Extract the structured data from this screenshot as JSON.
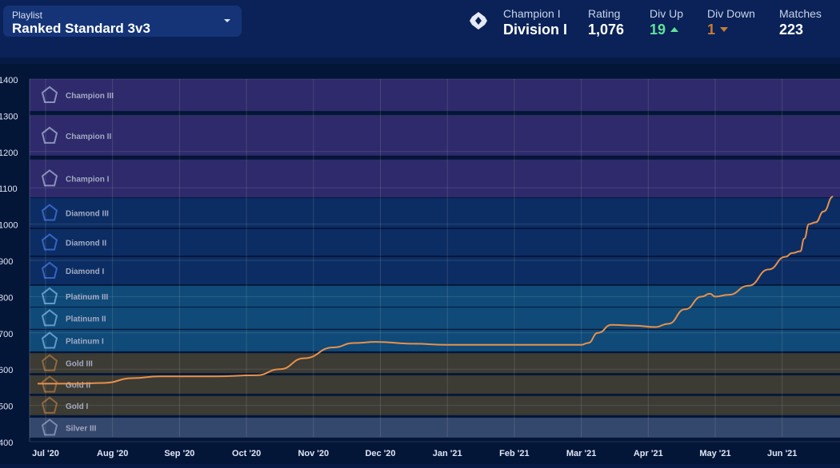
{
  "playlist": {
    "label": "Playlist",
    "value": "Ranked Standard 3v3"
  },
  "summary": {
    "rank": "Champion I",
    "division": "Division I",
    "rating_label": "Rating",
    "rating": "1,076",
    "div_up_label": "Div Up",
    "div_up": "19",
    "div_down_label": "Div Down",
    "div_down": "1",
    "matches_label": "Matches",
    "matches": "223"
  },
  "colors": {
    "line": "#e8914a",
    "champion": "#2e2a6b",
    "diamond": "#0c2d63",
    "platinum": "#0f4a78",
    "gold": "#3c3b34",
    "silver": "#34476c",
    "up": "#5fe39a",
    "down": "#c97b34"
  },
  "chart_data": {
    "type": "line",
    "title": "",
    "xlabel": "",
    "ylabel": "Rating",
    "ylim": [
      400,
      1400
    ],
    "yticks": [
      "400",
      "500",
      "600",
      "700",
      "800",
      "900",
      "1000",
      "1100",
      "1200",
      "1300",
      "1400"
    ],
    "xticks": [
      "Jul '20",
      "Aug '20",
      "Sep '20",
      "Oct '20",
      "Nov '20",
      "Dec '20",
      "Jan '21",
      "Feb '21",
      "Mar '21",
      "Apr '21",
      "May '21",
      "Jun '21"
    ],
    "x_units": "months since Jul '20",
    "tiers": [
      {
        "name": "Champion III",
        "min": 1312,
        "max": 1400,
        "group": "champion"
      },
      {
        "name": "Champion II",
        "min": 1189,
        "max": 1299,
        "group": "champion"
      },
      {
        "name": "Champion I",
        "min": 1074,
        "max": 1178,
        "group": "champion"
      },
      {
        "name": "Diamond III",
        "min": 990,
        "max": 1072,
        "group": "diamond"
      },
      {
        "name": "Diamond II",
        "min": 913,
        "max": 986,
        "group": "diamond"
      },
      {
        "name": "Diamond I",
        "min": 834,
        "max": 909,
        "group": "diamond"
      },
      {
        "name": "Platinum III",
        "min": 772,
        "max": 830,
        "group": "platinum"
      },
      {
        "name": "Platinum II",
        "min": 711,
        "max": 770,
        "group": "platinum"
      },
      {
        "name": "Platinum I",
        "min": 649,
        "max": 708,
        "group": "platinum"
      },
      {
        "name": "Gold III",
        "min": 589,
        "max": 644,
        "group": "gold"
      },
      {
        "name": "Gold II",
        "min": 532,
        "max": 583,
        "group": "gold"
      },
      {
        "name": "Gold I",
        "min": 473,
        "max": 526,
        "group": "gold"
      },
      {
        "name": "Silver III",
        "min": 411,
        "max": 466,
        "group": "silver"
      }
    ],
    "series": [
      {
        "name": "Rating",
        "points": [
          [
            -0.12,
            560
          ],
          [
            0.5,
            560
          ],
          [
            0.87,
            562
          ],
          [
            1.3,
            575
          ],
          [
            1.7,
            580
          ],
          [
            2.5,
            580
          ],
          [
            3.15,
            583
          ],
          [
            3.5,
            600
          ],
          [
            3.86,
            630
          ],
          [
            4.3,
            660
          ],
          [
            4.6,
            672
          ],
          [
            4.93,
            675
          ],
          [
            5.5,
            670
          ],
          [
            6.0,
            667
          ],
          [
            7.0,
            667
          ],
          [
            8.0,
            667
          ],
          [
            8.1,
            672
          ],
          [
            8.25,
            700
          ],
          [
            8.45,
            722
          ],
          [
            8.8,
            720
          ],
          [
            9.1,
            716
          ],
          [
            9.3,
            725
          ],
          [
            9.55,
            765
          ],
          [
            9.8,
            800
          ],
          [
            9.92,
            808
          ],
          [
            10.0,
            800
          ],
          [
            10.2,
            805
          ],
          [
            10.5,
            830
          ],
          [
            10.8,
            875
          ],
          [
            11.05,
            910
          ],
          [
            11.15,
            920
          ],
          [
            11.27,
            925
          ],
          [
            11.33,
            960
          ],
          [
            11.4,
            1000
          ],
          [
            11.5,
            1005
          ],
          [
            11.62,
            1035
          ],
          [
            11.76,
            1076
          ]
        ]
      }
    ]
  }
}
